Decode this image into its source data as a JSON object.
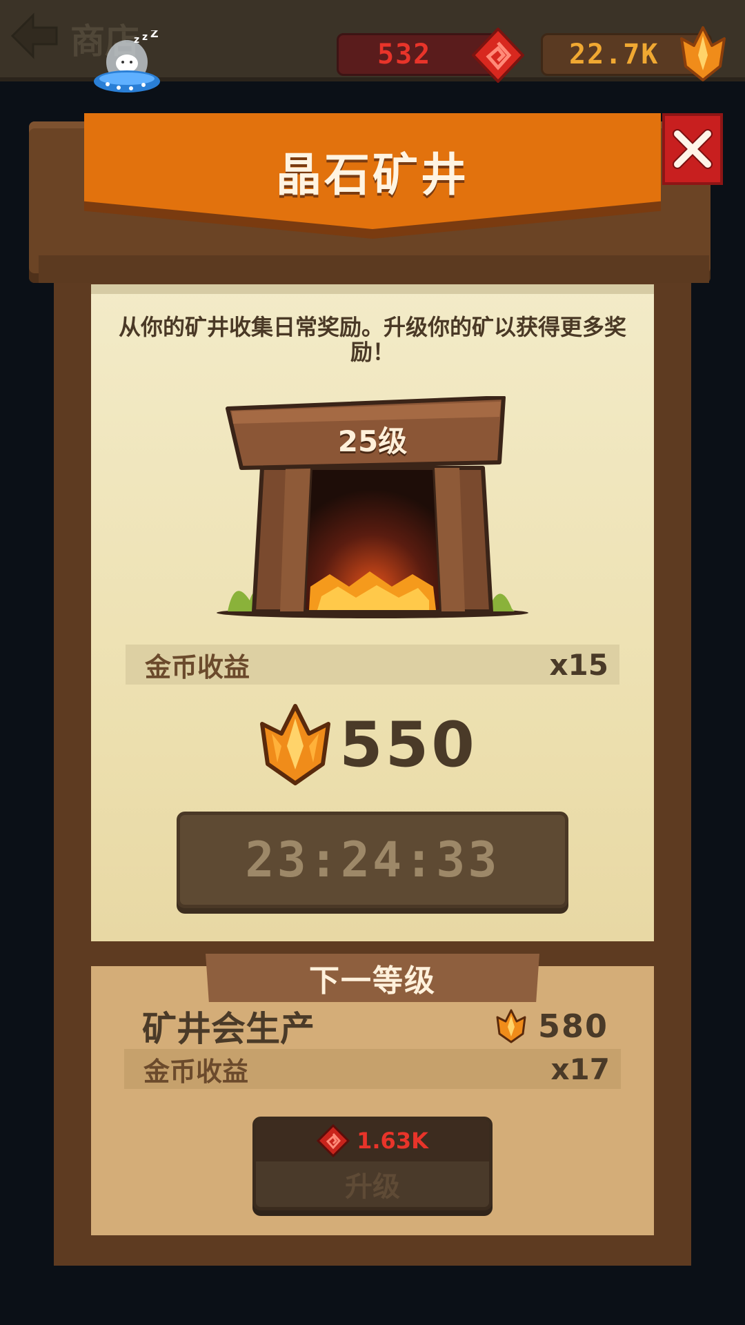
{
  "header": {
    "shop_title": "商店",
    "gems": "532",
    "crystals": "22.7K"
  },
  "dialog": {
    "title": "晶石矿井",
    "description": "从你的矿井收集日常奖励。升级你的矿以获得更多奖励！",
    "mine_level": "25级",
    "current": {
      "coin_income_label": "金币收益",
      "coin_multiplier": "x15",
      "reward": "550",
      "timer": "23:24:33"
    },
    "next_level": {
      "title": "下一等级",
      "produce_label": "矿井会生产",
      "produce_value": "580",
      "coin_income_label": "金币收益",
      "coin_multiplier": "x17",
      "upgrade_cost": "1.63K",
      "upgrade_label": "升级"
    }
  },
  "colors": {
    "banner": "#e2720d",
    "close": "#c81f1f",
    "gem_red": "#e8342a",
    "crystal_orange": "#f0a832"
  }
}
